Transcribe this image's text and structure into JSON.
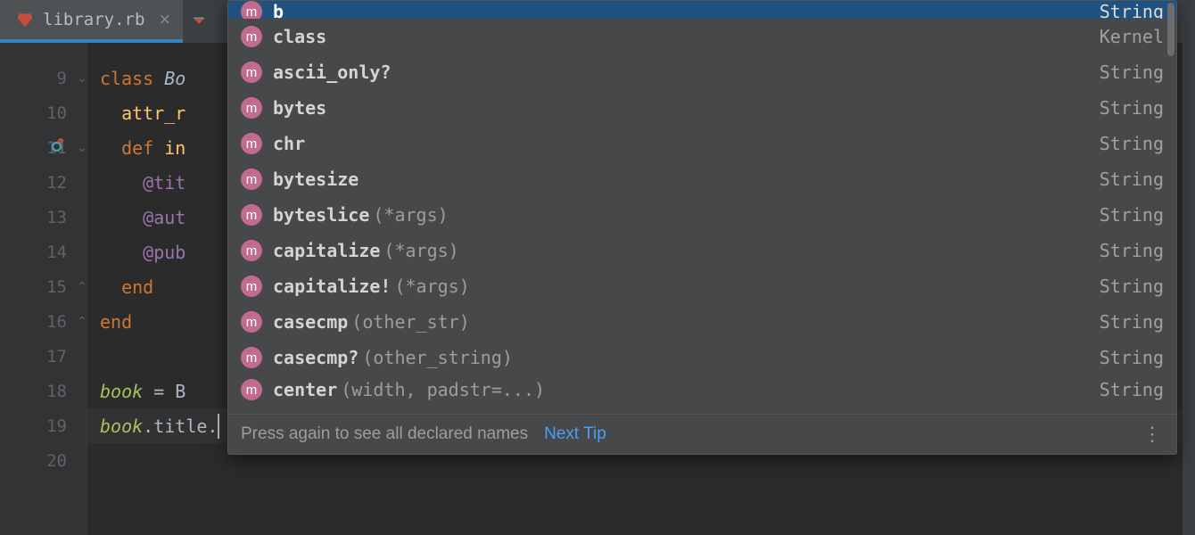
{
  "tab": {
    "filename": "library.rb"
  },
  "gutter": {
    "start": 9,
    "count": 12,
    "markedLine": 11
  },
  "code": {
    "lines": [
      {
        "tokens": [
          {
            "t": "class ",
            "c": "kw"
          },
          {
            "t": "Bo",
            "c": "cls"
          }
        ],
        "fold": "open"
      },
      {
        "tokens": [
          {
            "t": "  attr_r",
            "c": "fn"
          }
        ]
      },
      {
        "tokens": [
          {
            "t": "  ",
            "c": "plain"
          },
          {
            "t": "def ",
            "c": "kw"
          },
          {
            "t": "in",
            "c": "fn"
          }
        ],
        "fold": "open"
      },
      {
        "tokens": [
          {
            "t": "    ",
            "c": "plain"
          },
          {
            "t": "@tit",
            "c": "ivar"
          }
        ]
      },
      {
        "tokens": [
          {
            "t": "    ",
            "c": "plain"
          },
          {
            "t": "@aut",
            "c": "ivar"
          }
        ]
      },
      {
        "tokens": [
          {
            "t": "    ",
            "c": "plain"
          },
          {
            "t": "@pub",
            "c": "ivar"
          }
        ]
      },
      {
        "tokens": [
          {
            "t": "  ",
            "c": "plain"
          },
          {
            "t": "end",
            "c": "kw"
          }
        ],
        "fold": "close"
      },
      {
        "tokens": [
          {
            "t": "end",
            "c": "kw"
          }
        ],
        "fold": "close"
      },
      {
        "tokens": []
      },
      {
        "tokens": [
          {
            "t": "book",
            "c": "var"
          },
          {
            "t": " = B",
            "c": "plain"
          }
        ]
      },
      {
        "tokens": [
          {
            "t": "book",
            "c": "var"
          },
          {
            "t": ".title.",
            "c": "plain"
          }
        ],
        "caret": true,
        "hl": true
      },
      {
        "tokens": []
      }
    ]
  },
  "popup": {
    "items": [
      {
        "name": "b",
        "args": "",
        "type": "String",
        "sel": true,
        "cutTop": true
      },
      {
        "name": "class",
        "args": "",
        "type": "Kernel"
      },
      {
        "name": "ascii_only?",
        "args": "",
        "type": "String"
      },
      {
        "name": "bytes",
        "args": "",
        "type": "String"
      },
      {
        "name": "chr",
        "args": "",
        "type": "String"
      },
      {
        "name": "bytesize",
        "args": "",
        "type": "String"
      },
      {
        "name": "byteslice",
        "args": "(*args)",
        "type": "String"
      },
      {
        "name": "capitalize",
        "args": "(*args)",
        "type": "String"
      },
      {
        "name": "capitalize!",
        "args": "(*args)",
        "type": "String"
      },
      {
        "name": "casecmp",
        "args": "(other_str)",
        "type": "String"
      },
      {
        "name": "casecmp?",
        "args": "(other_string)",
        "type": "String"
      },
      {
        "name": "center",
        "args": "(width, padstr=...)",
        "type": "String",
        "cutBottom": true
      }
    ],
    "hint": "Press again to see all declared names",
    "link": "Next Tip",
    "dots": "⋮"
  }
}
